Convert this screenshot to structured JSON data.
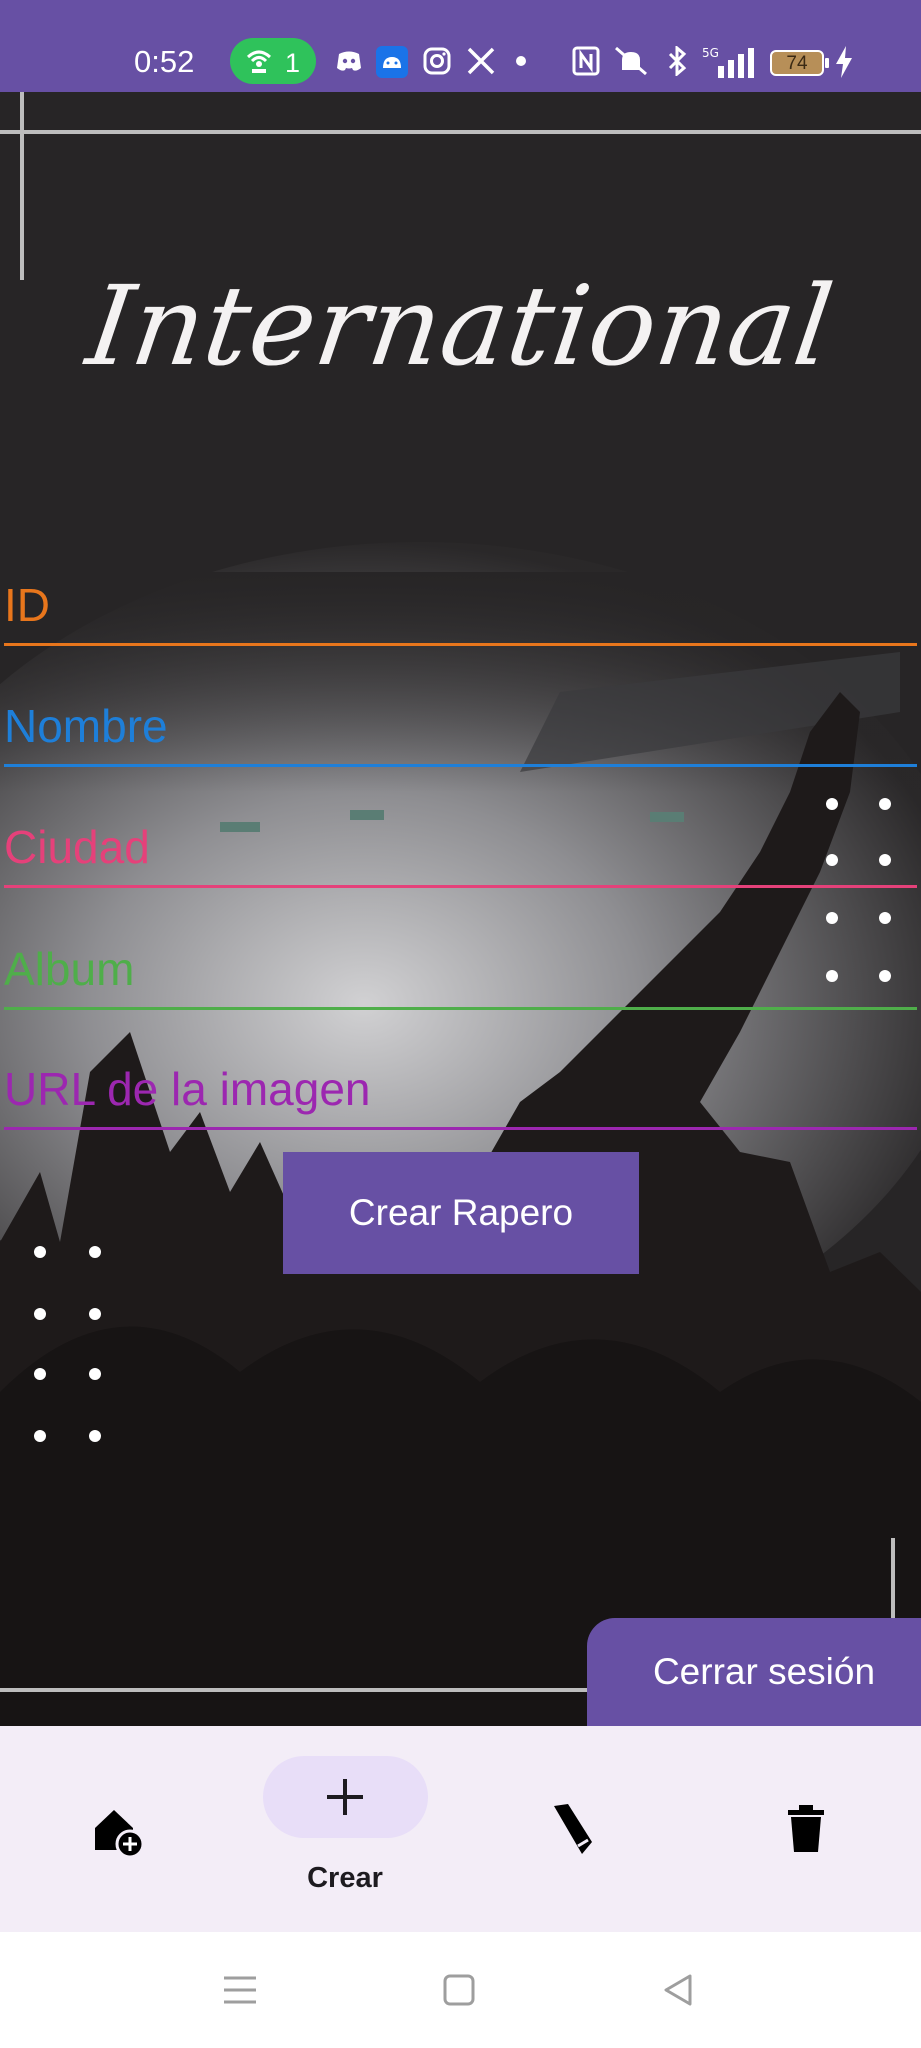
{
  "status_bar": {
    "time": "0:52",
    "hotspot_count": "1",
    "battery_level": "74",
    "icons": [
      "hotspot-icon",
      "discord-icon",
      "android-icon",
      "instagram-icon",
      "x-icon",
      "dot-icon",
      "nfc-icon",
      "mute-icon",
      "bluetooth-icon",
      "signal-5g-icon",
      "battery-icon",
      "charging-icon"
    ]
  },
  "header": {
    "logo_text": "International"
  },
  "form": {
    "fields": [
      {
        "label": "ID",
        "color": "#e8761c"
      },
      {
        "label": "Nombre",
        "color": "#1e7fd9"
      },
      {
        "label": "Ciudad",
        "color": "#e5417a"
      },
      {
        "label": "Album",
        "color": "#4fae4a"
      },
      {
        "label": "URL de la imagen",
        "color": "#9c27b0"
      }
    ],
    "submit_label": "Crear Rapero"
  },
  "logout_label": "Cerrar sesión",
  "bottom_nav": {
    "items": [
      {
        "icon": "home-add-icon",
        "label": ""
      },
      {
        "icon": "plus-icon",
        "label": "Crear",
        "active": true
      },
      {
        "icon": "edit-icon",
        "label": ""
      },
      {
        "icon": "trash-icon",
        "label": ""
      }
    ]
  },
  "system_nav": {
    "icons": [
      "menu-icon",
      "home-square-icon",
      "back-triangle-icon"
    ]
  },
  "colors": {
    "primary": "#6750a4",
    "nav_background": "#f3edf7",
    "nav_active_pill": "#e8def8"
  }
}
